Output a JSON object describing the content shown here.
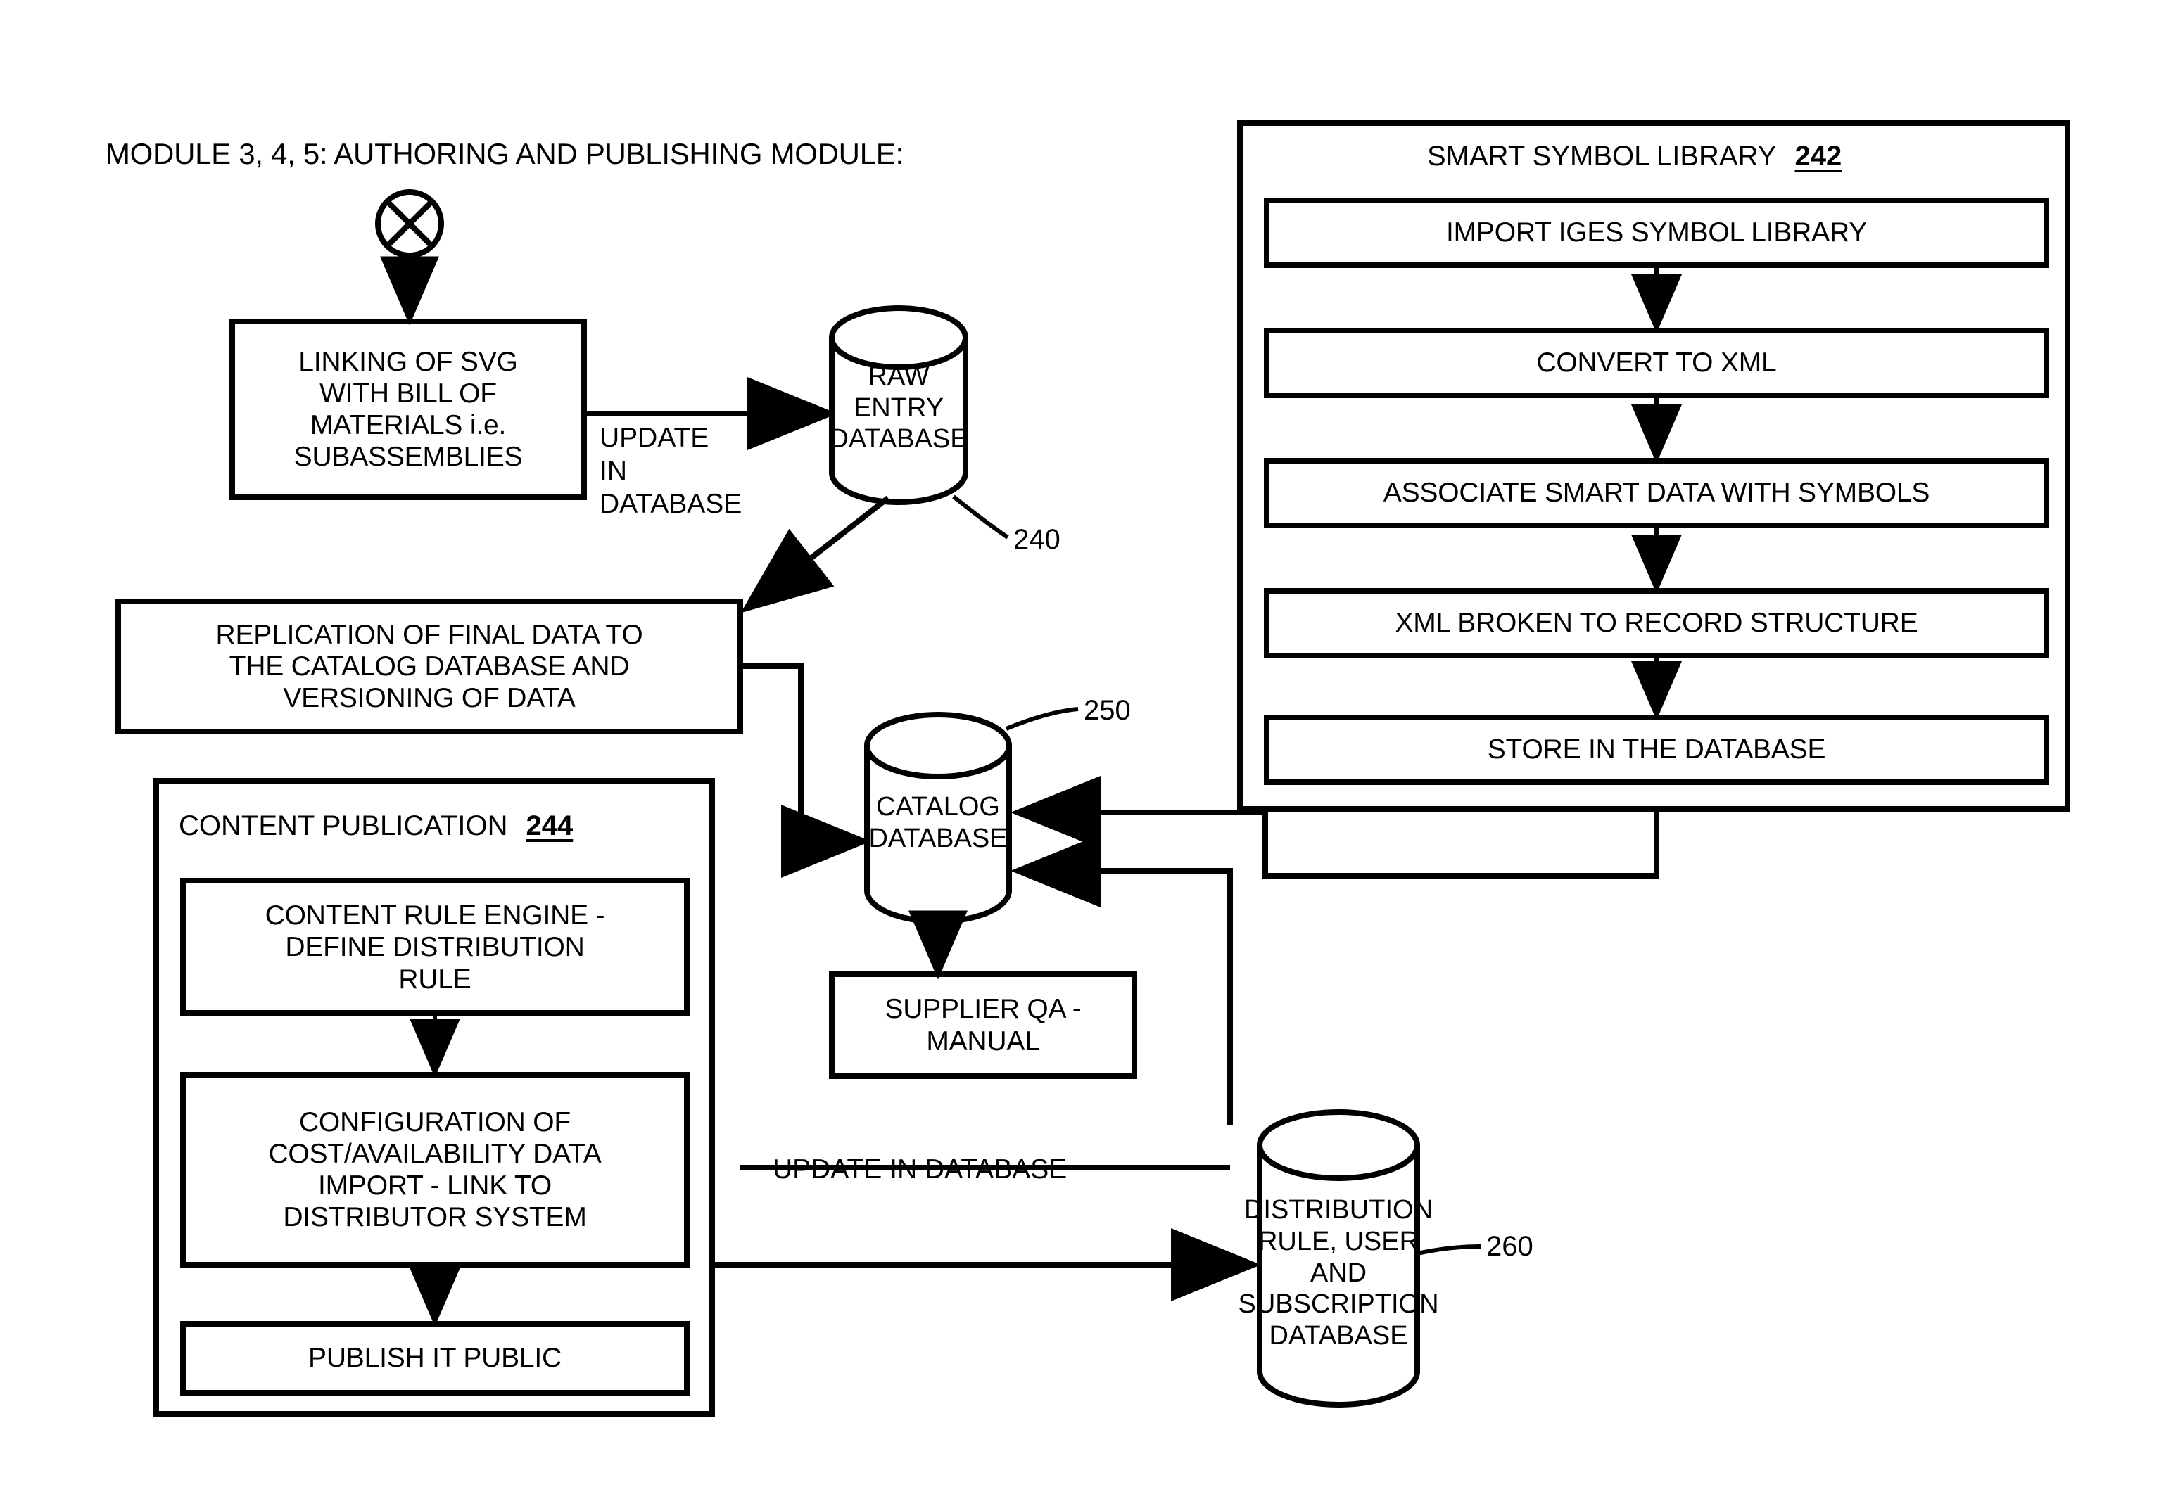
{
  "diagram": {
    "title": "MODULE 3, 4, 5: AUTHORING AND PUBLISHING MODULE:",
    "connector_symbol": "circle-x-connector"
  },
  "nodes": {
    "linking_svg": "LINKING OF SVG\nWITH BILL OF\nMATERIALS i.e.\nSUBASSEMBLIES",
    "replication": "REPLICATION OF FINAL DATA TO\nTHE CATALOG DATABASE AND\nVERSIONING OF DATA",
    "supplier_qa": "SUPPLIER QA -\nMANUAL"
  },
  "databases": {
    "raw_entry": {
      "label": "RAW ENTRY\nDATABASE",
      "ref": "240"
    },
    "catalog": {
      "label": "CATALOG\nDATABASE",
      "ref": "250"
    },
    "distribution": {
      "label": "DISTRIBUTION\nRULE, USER AND\nSUBSCRIPTION\nDATABASE",
      "ref": "260"
    }
  },
  "edge_labels": {
    "update_in_database_multiline": "UPDATE\nIN\nDATABASE",
    "update_in_database_inline": "UPDATE IN DATABASE"
  },
  "smart_symbol_library": {
    "title": "SMART SYMBOL LIBRARY",
    "ref": "242",
    "steps": [
      "IMPORT IGES SYMBOL LIBRARY",
      "CONVERT TO XML",
      "ASSOCIATE SMART DATA WITH SYMBOLS",
      "XML BROKEN TO RECORD STRUCTURE",
      "STORE IN THE DATABASE"
    ]
  },
  "content_publication": {
    "title": "CONTENT PUBLICATION",
    "ref": "244",
    "steps": [
      "CONTENT RULE ENGINE -\nDEFINE DISTRIBUTION\nRULE",
      "CONFIGURATION OF\nCOST/AVAILABILITY DATA\nIMPORT - LINK TO\nDISTRIBUTOR SYSTEM",
      "PUBLISH IT PUBLIC"
    ]
  },
  "colors": {
    "stroke": "#000000",
    "background": "#ffffff"
  }
}
